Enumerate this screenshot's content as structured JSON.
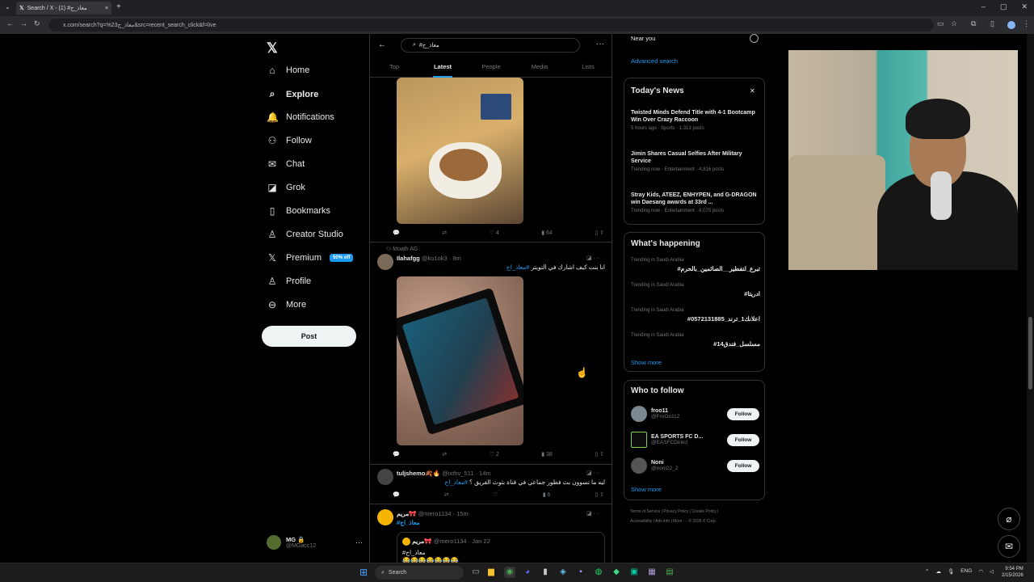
{
  "browser": {
    "tab_title": "Search / X - معاذ_ج# (1)",
    "tab_close": "×",
    "new_tab": "+",
    "url": "x.com/search?q=%23معاذ_ج&src=recent_search_click&f=live",
    "window_controls": [
      "–",
      "▢",
      "✕"
    ]
  },
  "logo": "𝕏",
  "nav": [
    {
      "label": "Home",
      "icon": "home-icon",
      "glyph": "⌂"
    },
    {
      "label": "Explore",
      "icon": "search-icon",
      "glyph": "⌕"
    },
    {
      "label": "Notifications",
      "icon": "bell-icon",
      "glyph": "🔔"
    },
    {
      "label": "Follow",
      "icon": "person-plus-icon",
      "glyph": "⚇"
    },
    {
      "label": "Chat",
      "icon": "mail-icon",
      "glyph": "✉"
    },
    {
      "label": "Grok",
      "icon": "grok-icon",
      "glyph": "◪"
    },
    {
      "label": "Bookmarks",
      "icon": "bookmark-icon",
      "glyph": "▯"
    },
    {
      "label": "Creator Studio",
      "icon": "creator-icon",
      "glyph": "♙"
    },
    {
      "label": "Premium",
      "icon": "x-logo-icon",
      "glyph": "𝕏"
    },
    {
      "label": "Profile",
      "icon": "person-icon",
      "glyph": "♙"
    },
    {
      "label": "More",
      "icon": "more-circle-icon",
      "glyph": "⊖"
    }
  ],
  "premium_badge": "50% off",
  "post_button": "Post",
  "account": {
    "name": "MG 🔒",
    "handle": "@MGacc12",
    "more": "···"
  },
  "search": {
    "query": "#معاذ_ج",
    "back": "←",
    "more": "···"
  },
  "tabs": [
    "Top",
    "Latest",
    "People",
    "Media",
    "Lists"
  ],
  "tweets": [
    {
      "reply": "",
      "retweet": "",
      "like": "4",
      "views": "64"
    },
    {
      "social_context": "Moath AG",
      "name": "Ilahafgg",
      "handle": "@ko1ok3 · 9m",
      "text": "انا بنت كيف اشارك في التويتر",
      "hashtag": "#معاذ_اج",
      "reply": "",
      "retweet": "",
      "like": "2",
      "views": "38"
    },
    {
      "name": "tuljshemo🍂🔥",
      "handle": "@ixthv_511 · 14m",
      "text": "ليه ما تسوون بث فطور جماعي في قناة بثوث الفريق ؟",
      "hashtag": "#معاذ_اج",
      "reply": "",
      "retweet": "",
      "like": "",
      "views": "6"
    },
    {
      "name": "مريم🎀",
      "handle": "@mero1134 · 15m",
      "hashtag": "#معاذ_اج",
      "quote_name": "مريم🎀",
      "quote_handle": "@mero1134 · Jan 22",
      "quote_text": "#معاذ_اج",
      "quote_emoji": "😂😂😂😂😂😂😂"
    }
  ],
  "near_you": "Near you",
  "advanced_search": "Advanced search",
  "todays_news": {
    "title": "Today's News",
    "close": "✕",
    "items": [
      {
        "headline": "Twisted Minds Defend Title with 4-1 Bootcamp Win Over Crazy Raccoon",
        "meta": "5 hours ago · Sports · 1,313 posts"
      },
      {
        "headline": "Jimin Shares Casual Selfies After Military Service",
        "meta": "Trending now · Entertainment · 4,816 posts"
      },
      {
        "headline": "Stray Kids, ATEEZ, ENHYPEN, and G-DRAGON win Daesang awards at 33rd ...",
        "meta": "Trending now · Entertainment · 8,075 posts"
      }
    ]
  },
  "whats_happening": {
    "title": "What's happening",
    "items": [
      {
        "context": "Trending in Saudi Arabia",
        "name": "#تبرع_لتفطير__الصائمين_بالحرم"
      },
      {
        "context": "Trending in Saudi Arabia",
        "name": "#ادريتا"
      },
      {
        "context": "Trending in Saudi Arabia",
        "name": "#اعلانك1_ترند_0572131885"
      },
      {
        "context": "Trending in Saudi Arabia",
        "name": "#مسلسل_فندق14"
      }
    ],
    "show_more": "Show more",
    "dots": "···"
  },
  "who_to_follow": {
    "title": "Who to follow",
    "items": [
      {
        "name": "froo11",
        "handle": "@FroOo112"
      },
      {
        "name": "EA SPORTS FC D...",
        "handle": "@EASFCDirect"
      },
      {
        "name": "Noni",
        "handle": "@noni22_2"
      }
    ],
    "follow_label": "Follow",
    "show_more": "Show more"
  },
  "footer": {
    "line1": "Terms of Service  |  Privacy Policy  |  Cookie Policy  |",
    "line2": "Accessibility  |  Ads info  |  More ···  © 2026 X Corp."
  },
  "taskbar": {
    "search": "Search",
    "lang": "ENG",
    "time": "9:54 PM",
    "date": "2/15/2026"
  },
  "colors": {
    "accent": "#1d9bf0",
    "bg": "#000000",
    "border": "#2f3336"
  }
}
